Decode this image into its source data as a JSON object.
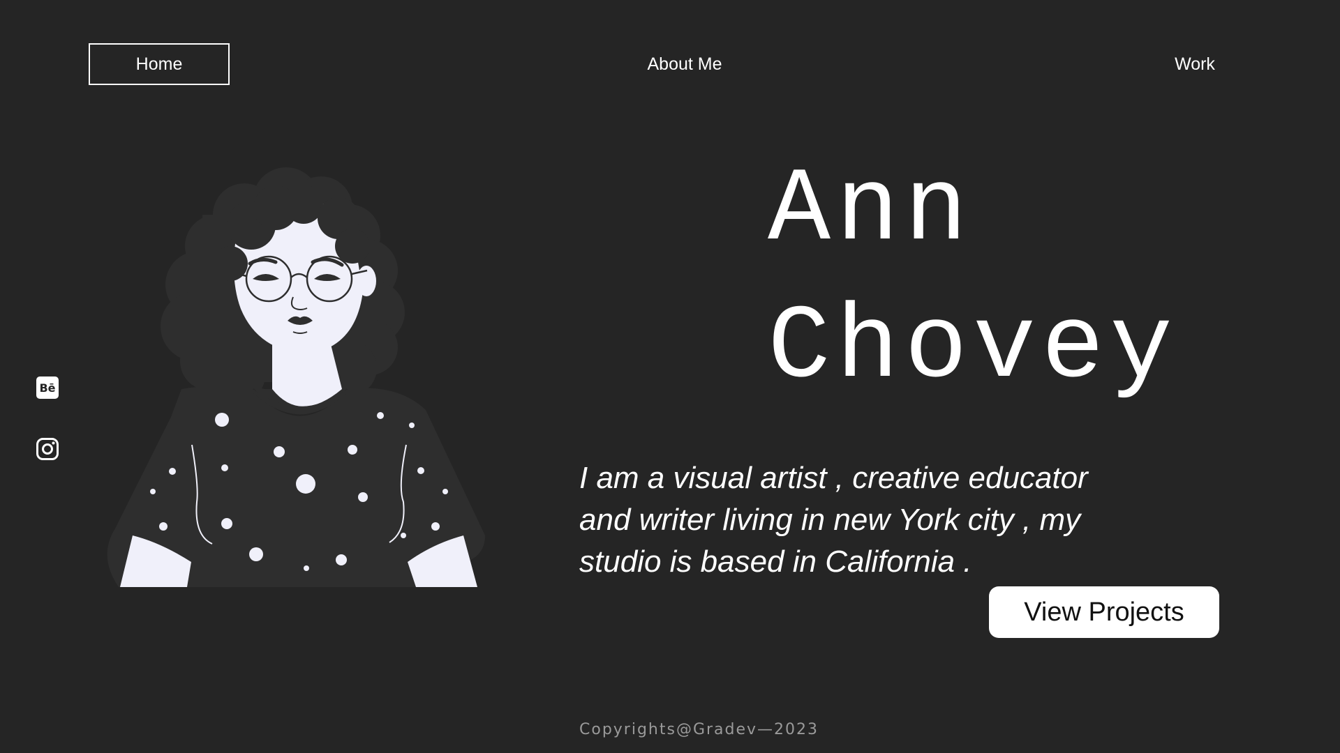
{
  "nav": {
    "home": "Home",
    "about": "About Me",
    "work": "Work"
  },
  "social": {
    "behance_icon": "behance-icon",
    "behance_glyph": "Bē",
    "instagram_icon": "instagram-icon"
  },
  "hero": {
    "first_name": "Ann",
    "last_name": "Chovey",
    "bio": "I am a visual artist , creative educator and writer living in new York city , my studio is based in California .",
    "cta": "View Projects"
  },
  "footer": {
    "copyright": "Copyrights@Gradev—2023"
  },
  "colors": {
    "background": "#252525",
    "text": "#ffffff",
    "illustration_light": "#f0f0fa",
    "illustration_dark": "#2e2e2e",
    "footer_text": "#9a9a9a"
  }
}
